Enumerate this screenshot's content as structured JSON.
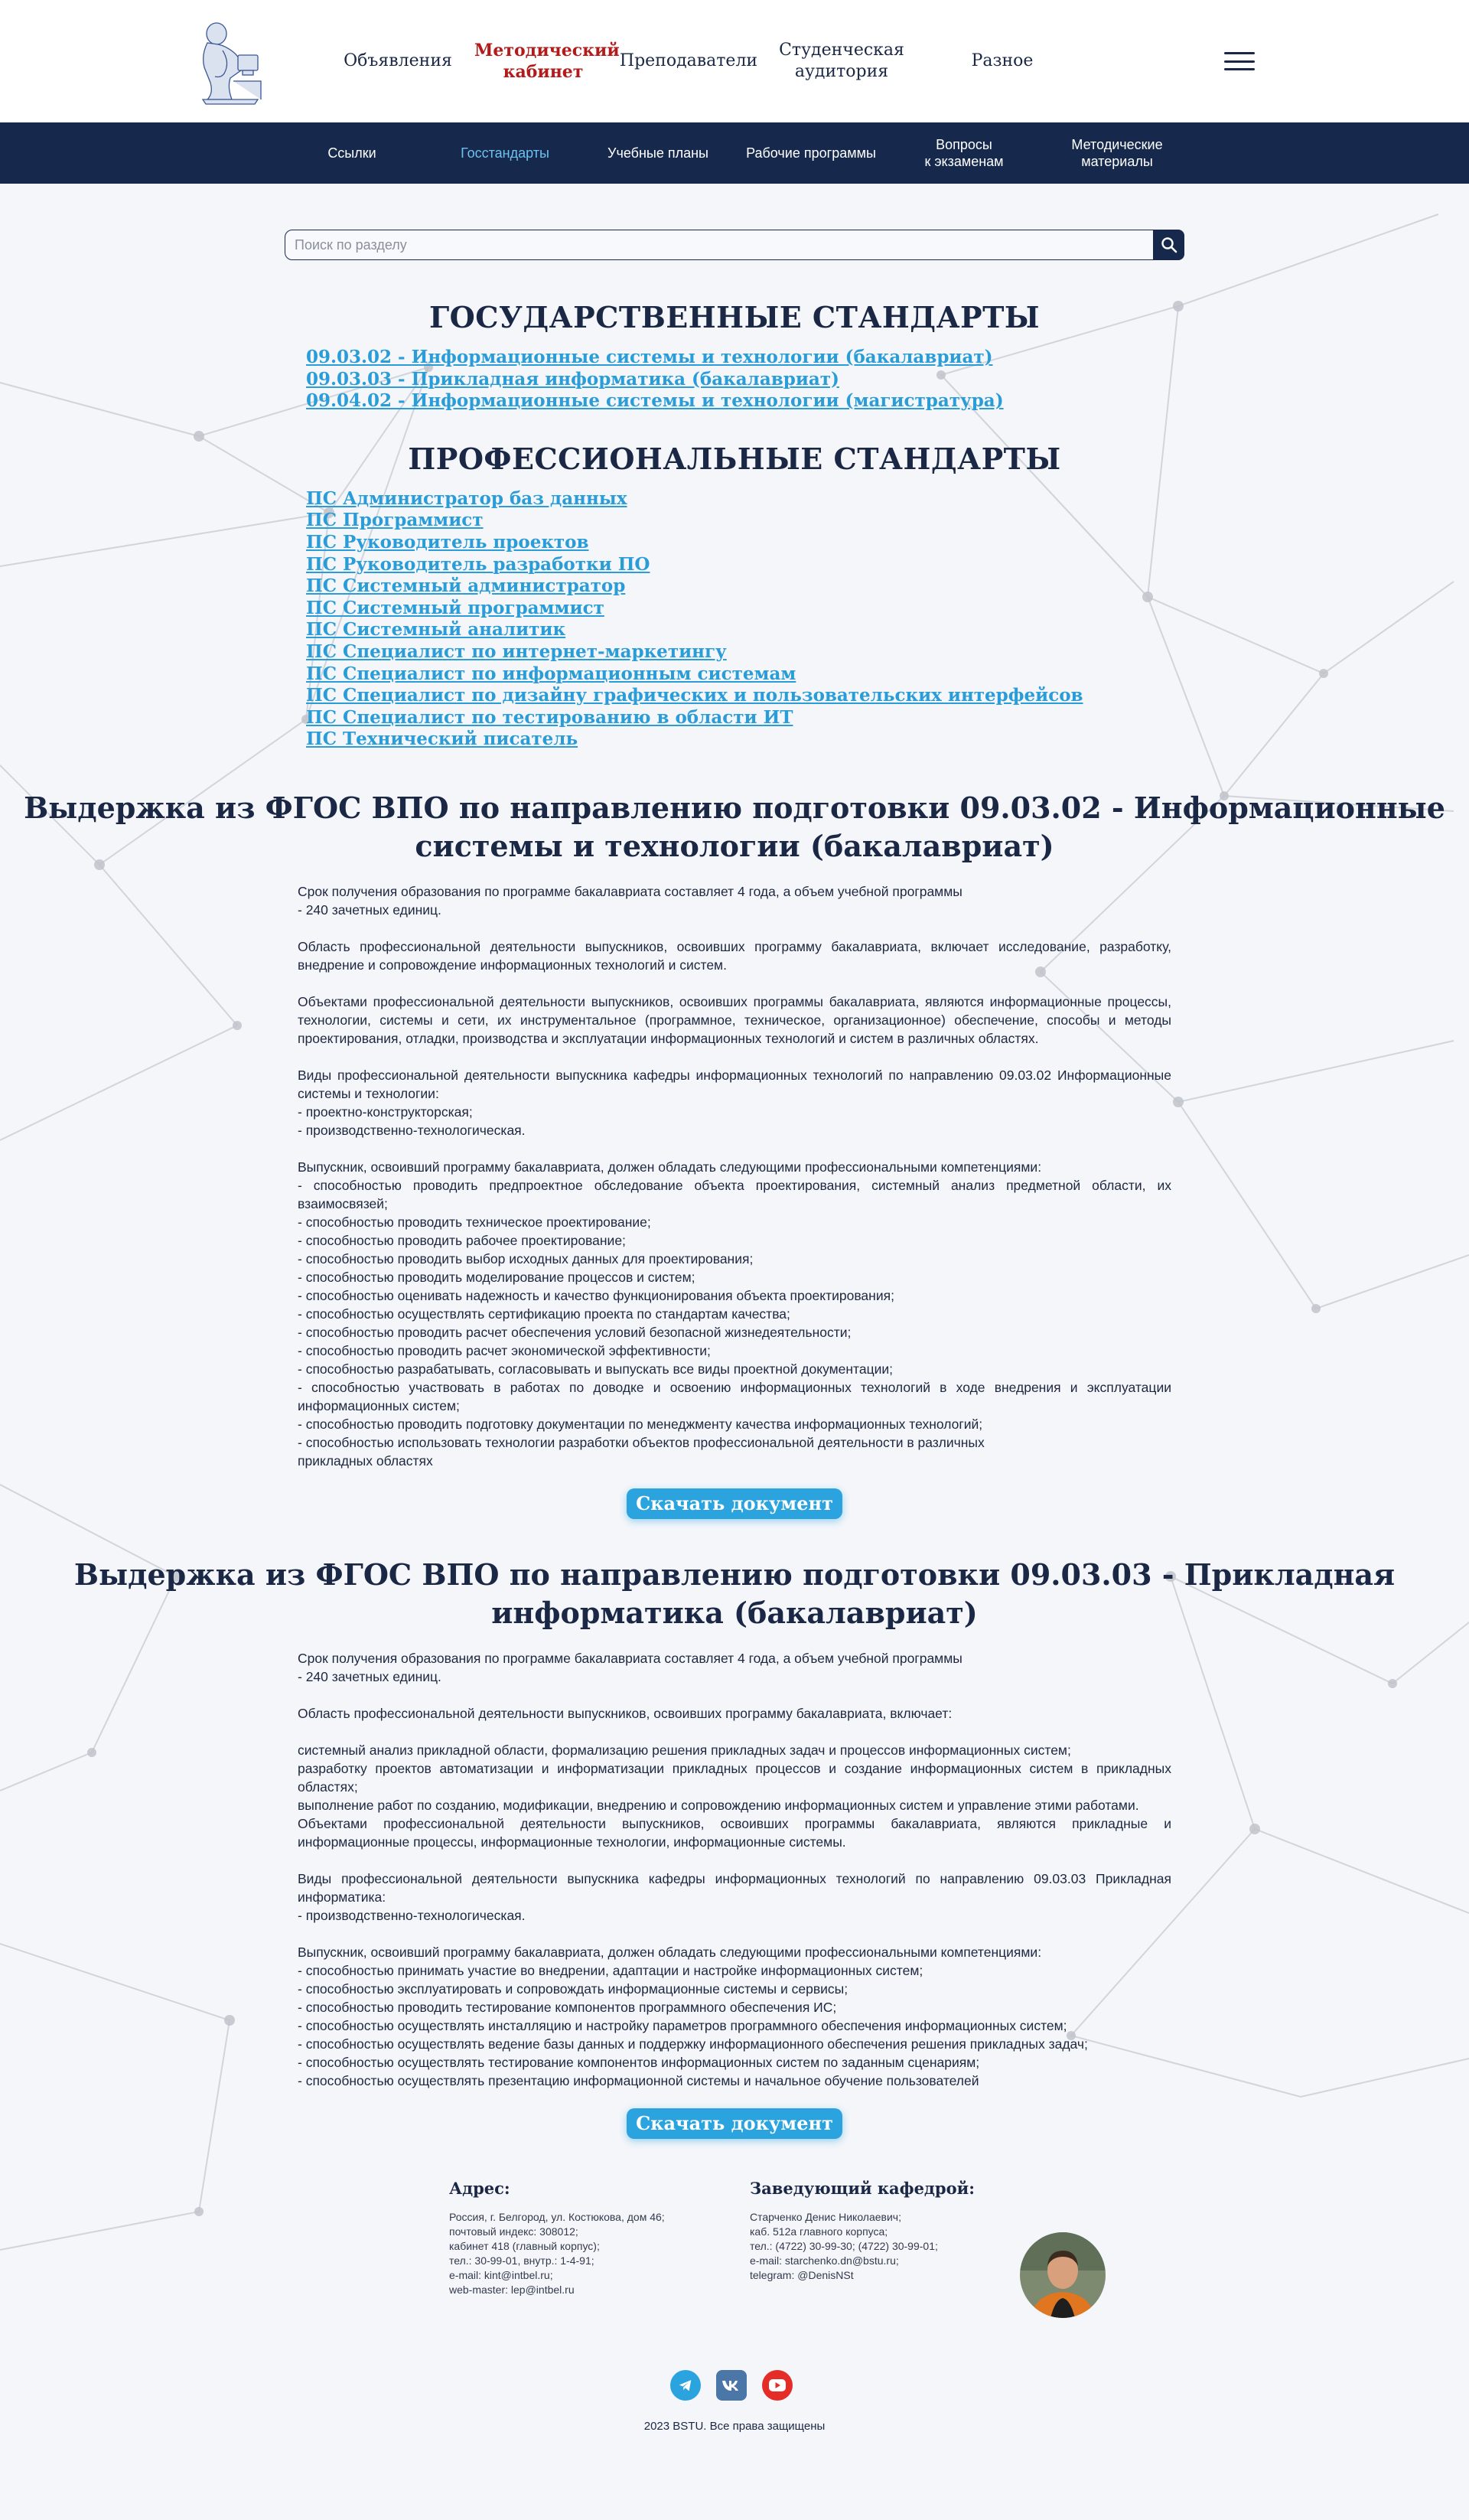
{
  "header": {
    "nav": [
      {
        "label": "Объявления"
      },
      {
        "label": "Методический\nкабинет"
      },
      {
        "label": "Преподаватели"
      },
      {
        "label": "Студенческая\nаудитория"
      },
      {
        "label": "Разное"
      }
    ],
    "colors": {
      "header_bg": "#ffffff",
      "active_nav": "#b31b1b"
    }
  },
  "subnav": {
    "items": [
      {
        "label": "Ссылки"
      },
      {
        "label": "Госстандарты",
        "active": true
      },
      {
        "label": "Учебные планы"
      },
      {
        "label": "Рабочие программы"
      },
      {
        "label": "Вопросы\nк экзаменам"
      },
      {
        "label": "Методические\nматериалы"
      }
    ],
    "colors": {
      "bg": "#16294d",
      "active": "#6ec1ef"
    }
  },
  "search": {
    "placeholder": "Поиск по разделу"
  },
  "gos": {
    "title": "ГОСУДАРСТВЕННЫЕ СТАНДАРТЫ",
    "links": [
      "09.03.02 - Информационные системы и технологии (бакалавриат)",
      "09.03.03 - Прикладная информатика (бакалавриат)",
      "09.04.02 - Информационные системы и технологии (магистратура)"
    ]
  },
  "prof": {
    "title": "ПРОФЕССИОНАЛЬНЫЕ СТАНДАРТЫ",
    "links": [
      "ПС Администратор баз данных",
      "ПС Программист",
      "ПС Руководитель проектов",
      "ПС Руководитель разработки ПО",
      "ПС Системный администратор",
      "ПС Системный программист",
      "ПС Системный аналитик",
      "ПС Специалист по интернет-маркетингу",
      "ПС Специалист по информационным системам",
      "ПС Специалист по дизайну графических и пользовательских интерфейсов",
      "ПС Специалист по тестированию в области ИТ",
      "ПС Технический писатель"
    ]
  },
  "fgos1": {
    "title1": "Выдержка из ФГОС ВПО по направлению подготовки",
    "title2": "09.03.02 - Информационные системы и технологии (бакалавриат)",
    "p1": [
      "Срок получения образования по программе бакалавриата составляет 4 года, а объем учебной программы",
      "- 240 зачетных единиц."
    ],
    "p2": "Область профессиональной деятельности выпускников, освоивших программу бакалавриата, включает исследование, разработку, внедрение и сопровождение информационных технологий и систем.",
    "p3": "Объектами профессиональной деятельности выпускников, освоивших программы бакалавриата, являются информационные процессы, технологии, системы и сети, их инструментальное (программное, техническое, организационное) обеспечение, способы и методы проектирования, отладки, производства и эксплуатации информационных технологий и систем в различных областях.",
    "p4": [
      "Виды профессиональной деятельности выпускника кафедры информационных технологий по направлению 09.03.02 Информационные системы и технологии:",
      "- проектно-конструкторская;",
      "- производственно-технологическая."
    ],
    "p5": [
      "Выпускник, освоивший программу бакалавриата, должен обладать следующими профессиональными компетенциями:",
      "- способностью проводить предпроектное обследование объекта проектирования, системный анализ предметной области, их взаимосвязей;",
      "- способностью проводить техническое проектирование;",
      "- способностью проводить рабочее проектирование;",
      "- способностью проводить выбор исходных данных для проектирования;",
      "- способностью проводить моделирование процессов и систем;",
      "- способностью оценивать надежность и качество функционирования объекта проектирования;",
      "- способностью осуществлять сертификацию проекта по стандартам качества;",
      "- способностью проводить расчет обеспечения условий безопасной жизнедеятельности;",
      "- способностью проводить расчет экономической эффективности;",
      "- способностью разрабатывать, согласовывать и выпускать все виды проектной документации;",
      "- способностью участвовать в работах по доводке и освоению информационных технологий в ходе внедрения и эксплуатации информационных систем;",
      "- способностью проводить подготовку документации по менеджменту качества информационных технологий;",
      "- способностью использовать технологии разработки объектов профессиональной деятельности в различных",
      "прикладных областях"
    ],
    "button": "Скачать документ"
  },
  "fgos2": {
    "title1": "Выдержка из ФГОС ВПО по направлению подготовки",
    "title2": "09.03.03 - Прикладная информатика (бакалавриат)",
    "p1": [
      "Срок получения образования по программе бакалавриата составляет 4 года, а объем учебной программы",
      "- 240 зачетных единиц."
    ],
    "p2": "Область профессиональной деятельности выпускников, освоивших программу бакалавриата, включает:",
    "p3": [
      "системный анализ прикладной области, формализацию решения прикладных задач и процессов информационных систем;",
      "разработку проектов автоматизации и информатизации прикладных процессов и создание информационных систем в прикладных областях;",
      "выполнение работ по созданию, модификации, внедрению и сопровождению информационных систем и управление этими работами.",
      "Объектами профессиональной деятельности выпускников, освоивших программы бакалавриата, являются прикладные и информационные процессы, информационные технологии, информационные системы."
    ],
    "p4": [
      "Виды профессиональной деятельности выпускника кафедры информационных технологий по направлению 09.03.03 Прикладная информатика:",
      "- производственно-технологическая."
    ],
    "p5": [
      "Выпускник, освоивший программу бакалавриата, должен обладать следующими профессиональными компетенциями:",
      "- способностью принимать участие во внедрении, адаптации и настройке информационных систем;",
      "- способностью эксплуатировать и сопровождать информационные системы и сервисы;",
      "- способностью проводить тестирование компонентов программного обеспечения ИС;",
      "- способностью осуществлять инсталляцию и настройку параметров программного обеспечения информационных систем;",
      "- способностью осуществлять ведение базы данных и поддержку информационного обеспечения решения прикладных задач;",
      "- способностью осуществлять тестирование компонентов информационных систем по заданным сценариям;",
      "- способностью осуществлять презентацию информационной системы и начальное обучение пользователей"
    ],
    "button": "Скачать документ"
  },
  "footer": {
    "address": {
      "title": "Адрес:",
      "lines": [
        "Россия, г. Белгород, ул. Костюкова, дом 46;",
        "почтовый индекс: 308012;",
        "кабинет 418 (главный корпус);",
        "тел.: 30-99-01, внутр.: 1-4-91;",
        "e-mail: kint@intbel.ru;",
        "web-master: lep@intbel.ru"
      ]
    },
    "head": {
      "title": "Заведующий кафедрой:",
      "lines": [
        "Старченко Денис Николаевич;",
        "каб. 512а главного корпуса;",
        "тел.: (4722) 30-99-30; (4722) 30-99-01;",
        "e-mail: starchenko.dn@bstu.ru;",
        "telegram: @DenisNSt"
      ]
    },
    "socials": [
      "telegram-icon",
      "vk-icon",
      "youtube-icon"
    ],
    "copyright": "2023 BSTU. Все права защищены",
    "colors": {
      "telegram": "#2aa3df",
      "vk": "#4a76a8",
      "youtube": "#e52d27"
    }
  }
}
